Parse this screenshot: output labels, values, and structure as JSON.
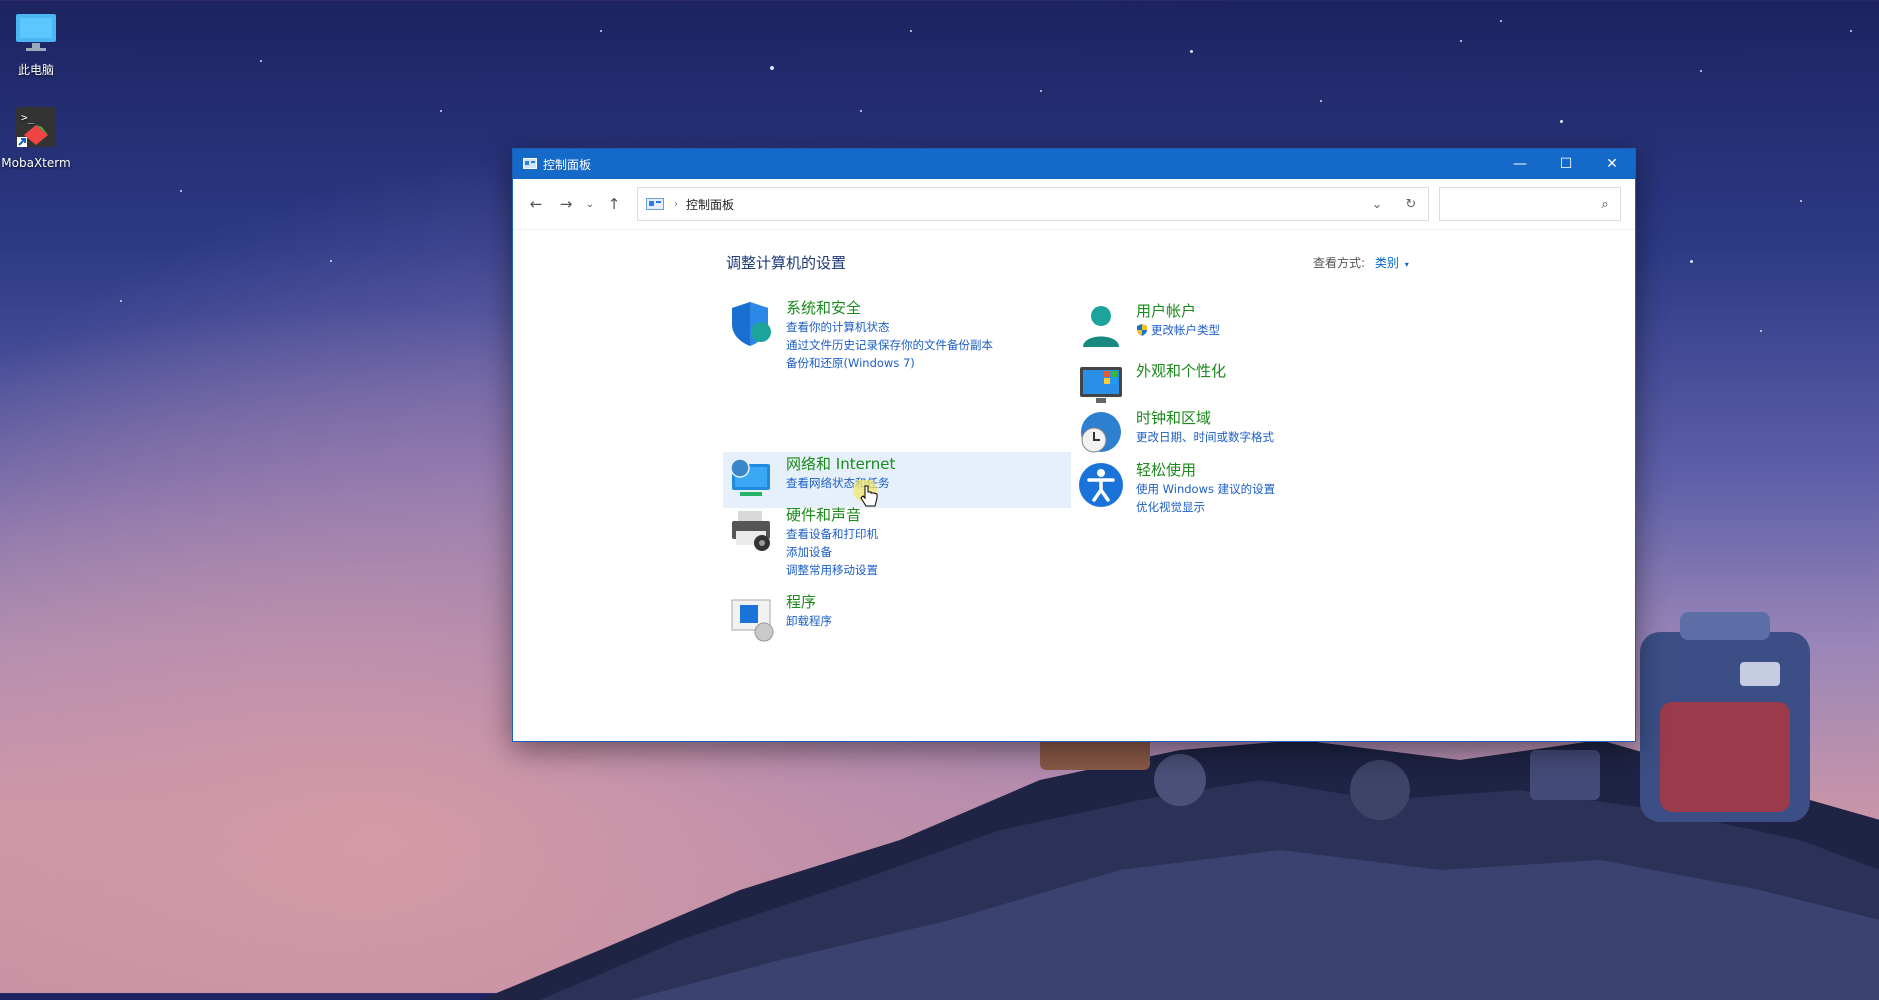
{
  "desktop": {
    "icons": [
      {
        "label": "此电脑",
        "icon": "monitor-icon"
      },
      {
        "label": "MobaXterm",
        "icon": "mobaxterm-icon"
      }
    ]
  },
  "window": {
    "title": "控制面板",
    "controls": {
      "minimize": "—",
      "maximize": "☐",
      "close": "✕"
    },
    "nav": {
      "back": "←",
      "forward": "→",
      "recent": "⌄",
      "up": "↑"
    },
    "address": {
      "crumb": "控制面板",
      "separator": "›",
      "dropdown": "⌄",
      "refresh": "↻"
    },
    "search": {
      "placeholder": "",
      "icon": "⌕"
    },
    "page_title": "调整计算机的设置",
    "view_by": {
      "label": "查看方式:",
      "value": "类别",
      "caret": "▾"
    },
    "categories_left": [
      {
        "title": "系统和安全",
        "icon": "shield-icon",
        "links": [
          "查看你的计算机状态",
          "通过文件历史记录保存你的文件备份副本",
          "备份和还原(Windows 7)"
        ]
      },
      {
        "title": "网络和 Internet",
        "icon": "network-icon",
        "links": [
          "查看网络状态和任务"
        ]
      },
      {
        "title": "硬件和声音",
        "icon": "printer-icon",
        "links": [
          "查看设备和打印机",
          "添加设备",
          "调整常用移动设置"
        ]
      },
      {
        "title": "程序",
        "icon": "programs-icon",
        "links": [
          "卸载程序"
        ]
      }
    ],
    "categories_right": [
      {
        "title": "用户帐户",
        "icon": "user-icon",
        "links": [
          "更改帐户类型"
        ]
      },
      {
        "title": "外观和个性化",
        "icon": "appearance-icon",
        "links": []
      },
      {
        "title": "时钟和区域",
        "icon": "clock-globe-icon",
        "links": [
          "更改日期、时间或数字格式"
        ]
      },
      {
        "title": "轻松使用",
        "icon": "accessibility-icon",
        "links": [
          "使用 Windows 建议的设置",
          "优化视觉显示"
        ]
      }
    ]
  },
  "colors": {
    "titlebar": "#1469c9",
    "link": "#1c5ec7",
    "category_title": "#1a8a1a"
  }
}
